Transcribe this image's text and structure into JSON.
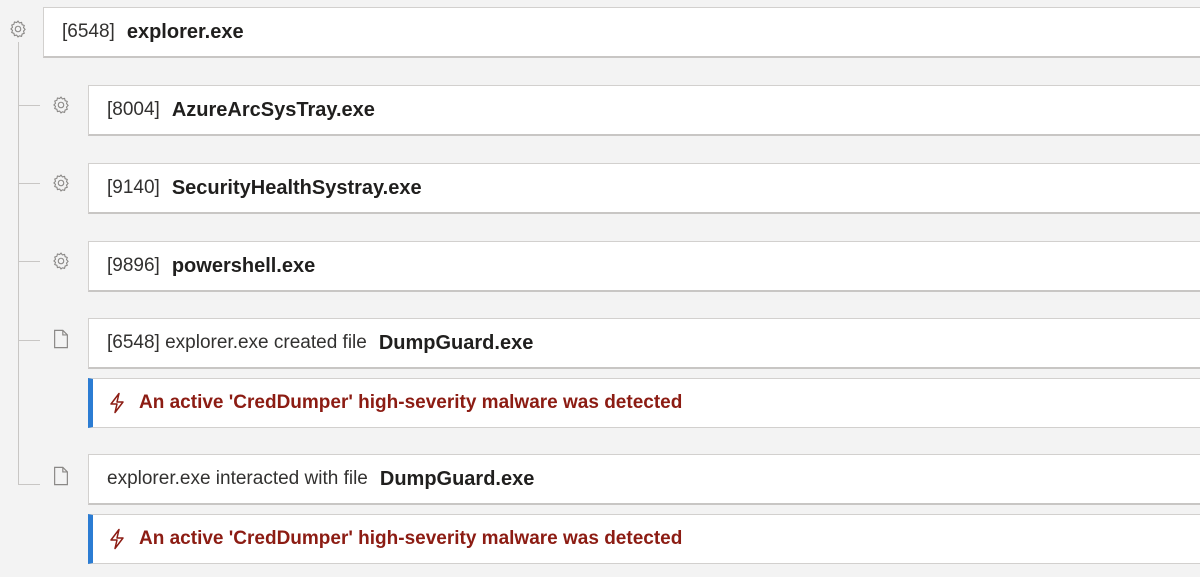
{
  "root": {
    "pid": "[6548]",
    "name": "explorer.exe",
    "icon": "gear-icon"
  },
  "children": [
    {
      "pid": "[8004]",
      "name": "AzureArcSysTray.exe",
      "icon": "gear-icon"
    },
    {
      "pid": "[9140]",
      "name": "SecurityHealthSystray.exe",
      "icon": "gear-icon"
    },
    {
      "pid": "[9896]",
      "name": "powershell.exe",
      "icon": "gear-icon"
    }
  ],
  "events": [
    {
      "description": "[6548] explorer.exe created file",
      "file": "DumpGuard.exe",
      "icon": "file-icon",
      "alert": "An active 'CredDumper' high-severity malware was detected",
      "alert_icon": "lightning-icon"
    },
    {
      "description": "explorer.exe interacted with file",
      "file": "DumpGuard.exe",
      "icon": "file-icon",
      "alert": "An active 'CredDumper' high-severity malware was detected",
      "alert_icon": "lightning-icon"
    }
  ],
  "colors": {
    "alert_accent": "#2b7cd3",
    "alert_text": "#8c1c13",
    "background": "#f3f3f3"
  }
}
